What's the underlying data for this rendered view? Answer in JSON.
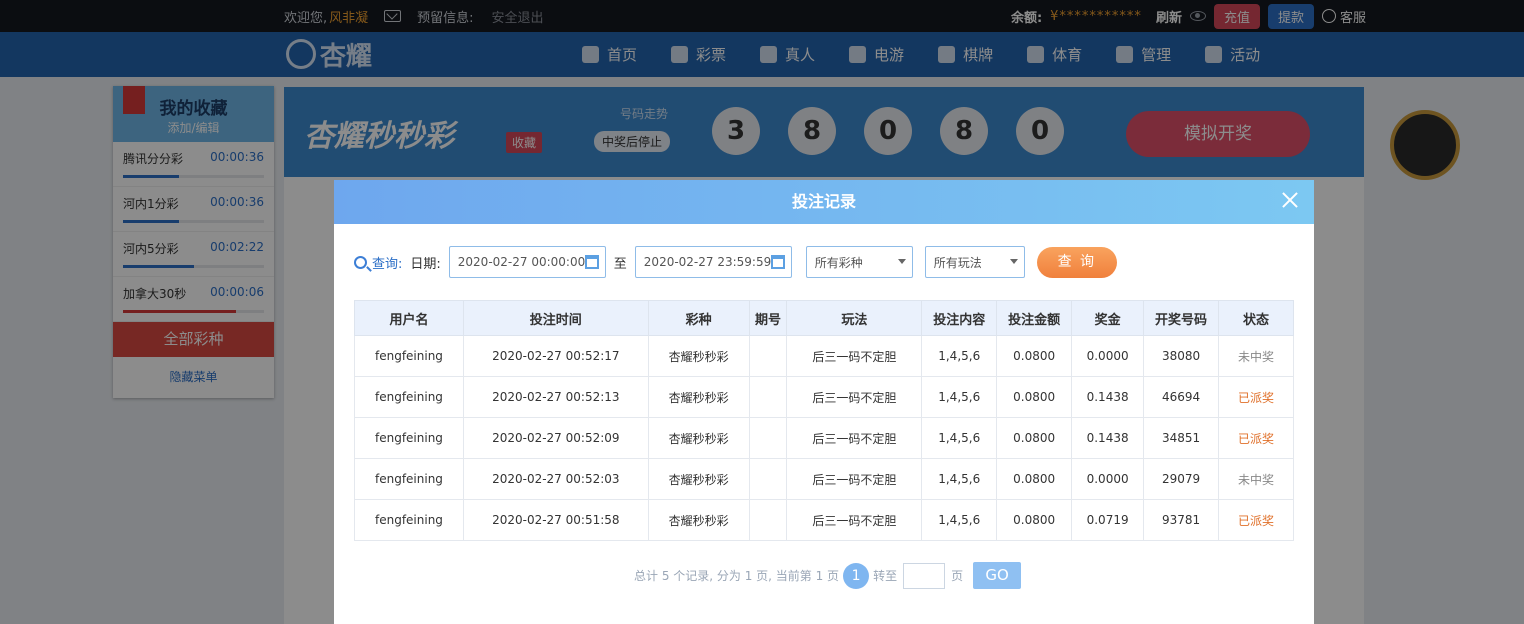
{
  "topbar": {
    "welcome": "欢迎您,",
    "username": "风非凝",
    "reserved_info": "预留信息:",
    "logout": "安全退出",
    "balance_label": "余额:",
    "balance_value": "¥***********",
    "refresh": "刷新",
    "recharge": "充值",
    "withdraw": "提款",
    "service": "客服"
  },
  "nav": {
    "logo": "杏耀",
    "items": [
      "首页",
      "彩票",
      "真人",
      "电游",
      "棋牌",
      "体育",
      "管理",
      "活动"
    ]
  },
  "favorites": {
    "title": "我的收藏",
    "edit": "添加/编辑",
    "items": [
      {
        "name": "腾讯分分彩",
        "time": "00:00:36",
        "progress": 0.4
      },
      {
        "name": "河内1分彩",
        "time": "00:00:36",
        "progress": 0.4
      },
      {
        "name": "河内5分彩",
        "time": "00:02:22",
        "progress": 0.5
      },
      {
        "name": "加拿大30秒",
        "time": "00:00:06",
        "progress": 0.8
      }
    ],
    "all_games": "全部彩种",
    "hide_menu": "隐藏菜单"
  },
  "game": {
    "title": "杏耀秒秒彩",
    "favorite_tag": "收藏",
    "trend": "号码走势",
    "stop_on_win": "中奖后停止",
    "balls": [
      "3",
      "8",
      "0",
      "8",
      "0"
    ],
    "simulate": "模拟开奖"
  },
  "modal": {
    "title": "投注记录",
    "query_label": "查询:",
    "date_label": "日期:",
    "date_from": "2020-02-27 00:00:00",
    "to_label": "至",
    "date_to": "2020-02-27 23:59:59",
    "lottery_select": "所有彩种",
    "play_select": "所有玩法",
    "query_button": "查 询",
    "columns": [
      "用户名",
      "投注时间",
      "彩种",
      "期号",
      "玩法",
      "投注内容",
      "投注金额",
      "奖金",
      "开奖号码",
      "状态"
    ],
    "rows": [
      [
        "fengfeining",
        "2020-02-27 00:52:17",
        "杏耀秒秒彩",
        "",
        "后三一码不定胆",
        "1,4,5,6",
        "0.0800",
        "0.0000",
        "38080",
        "未中奖"
      ],
      [
        "fengfeining",
        "2020-02-27 00:52:13",
        "杏耀秒秒彩",
        "",
        "后三一码不定胆",
        "1,4,5,6",
        "0.0800",
        "0.1438",
        "46694",
        "已派奖"
      ],
      [
        "fengfeining",
        "2020-02-27 00:52:09",
        "杏耀秒秒彩",
        "",
        "后三一码不定胆",
        "1,4,5,6",
        "0.0800",
        "0.1438",
        "34851",
        "已派奖"
      ],
      [
        "fengfeining",
        "2020-02-27 00:52:03",
        "杏耀秒秒彩",
        "",
        "后三一码不定胆",
        "1,4,5,6",
        "0.0800",
        "0.0000",
        "29079",
        "未中奖"
      ],
      [
        "fengfeining",
        "2020-02-27 00:51:58",
        "杏耀秒秒彩",
        "",
        "后三一码不定胆",
        "1,4,5,6",
        "0.0800",
        "0.0719",
        "93781",
        "已派奖"
      ]
    ],
    "pager": {
      "summary": "总计 5 个记录, 分为 1 页, 当前第 1 页",
      "current": "1",
      "goto": "转至",
      "page_unit": "页",
      "go": "GO"
    }
  }
}
